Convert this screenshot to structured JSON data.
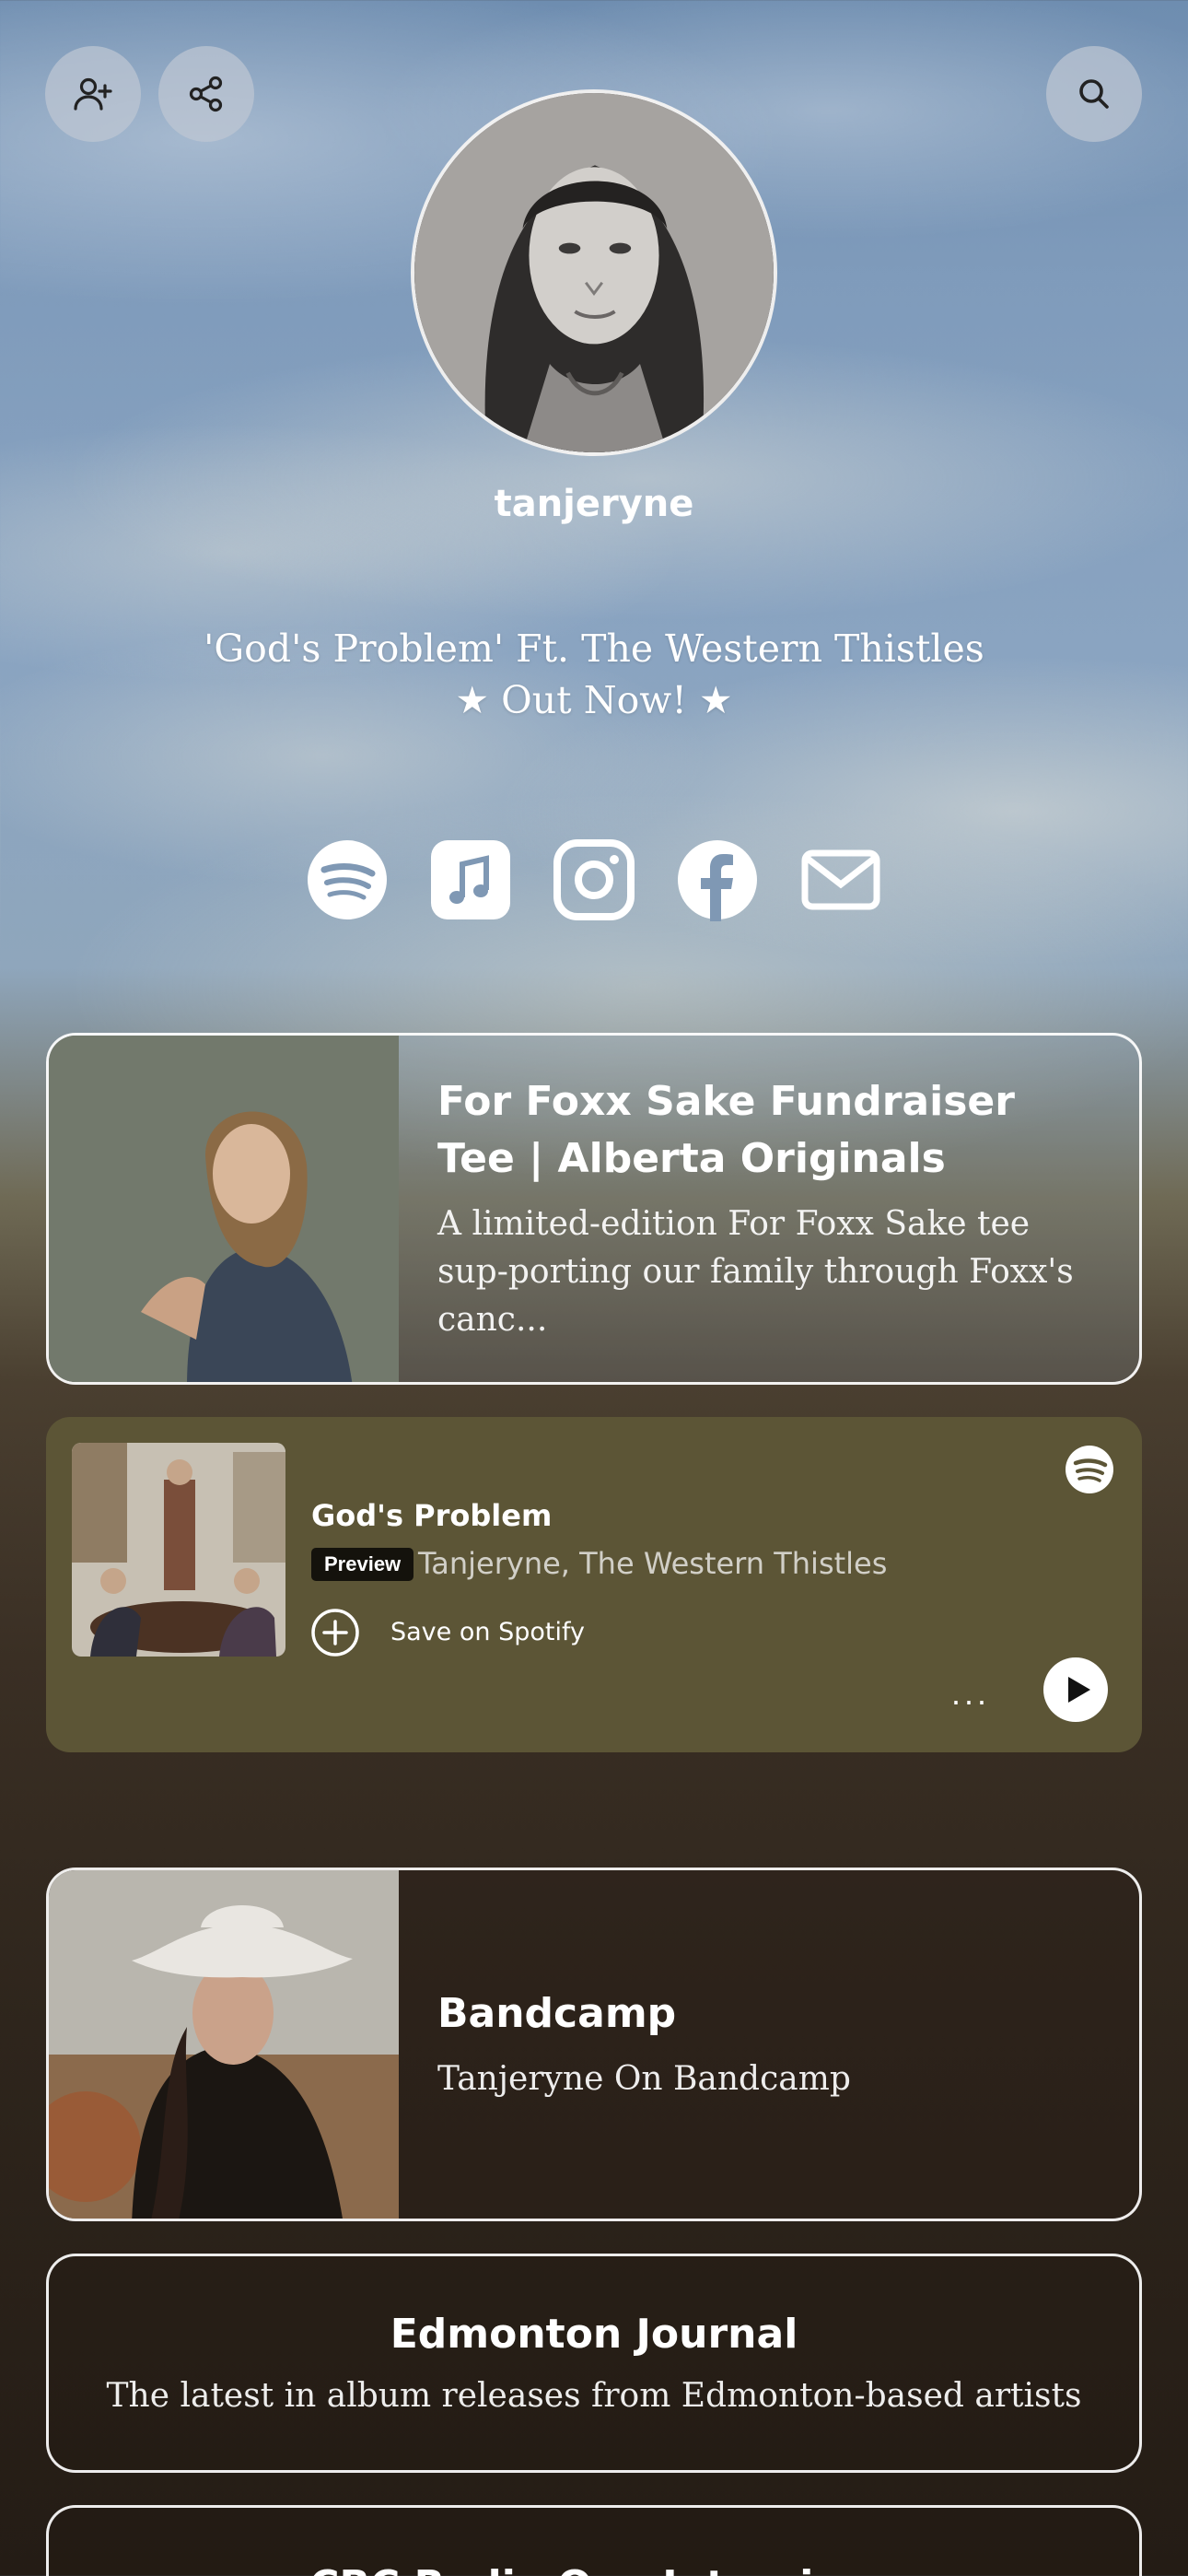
{
  "header": {
    "buttons": [
      {
        "icon": "add-user-icon"
      },
      {
        "icon": "share-icon"
      },
      {
        "icon": "search-icon"
      }
    ]
  },
  "profile": {
    "username": "tanjeryne",
    "tagline_line1": "'God's Problem' Ft. The Western Thistles",
    "tagline_line2": "★ Out Now! ★"
  },
  "socials": [
    {
      "icon": "spotify-icon"
    },
    {
      "icon": "apple-music-icon"
    },
    {
      "icon": "instagram-icon"
    },
    {
      "icon": "facebook-icon"
    },
    {
      "icon": "email-icon"
    }
  ],
  "links": {
    "fundraiser": {
      "title": "For Foxx Sake Fundraiser Tee | Alberta Originals",
      "description": "A limited-edition For Foxx Sake tee sup-porting our family through Foxx's canc..."
    },
    "bandcamp": {
      "title": "Bandcamp",
      "description": "Tanjeryne On Bandcamp"
    },
    "edmonton": {
      "title": "Edmonton Journal",
      "description": "The latest in album releases from Edmonton-based artists"
    },
    "cbc": {
      "title": "CBC Radio One Interview"
    }
  },
  "spotify_embed": {
    "track": "God's Problem",
    "preview_label": "Preview",
    "artists": "Tanjeryne, The Western Thistles",
    "save_label": "Save on Spotify",
    "more_label": "···",
    "colors": {
      "background": "#5c5536"
    }
  }
}
